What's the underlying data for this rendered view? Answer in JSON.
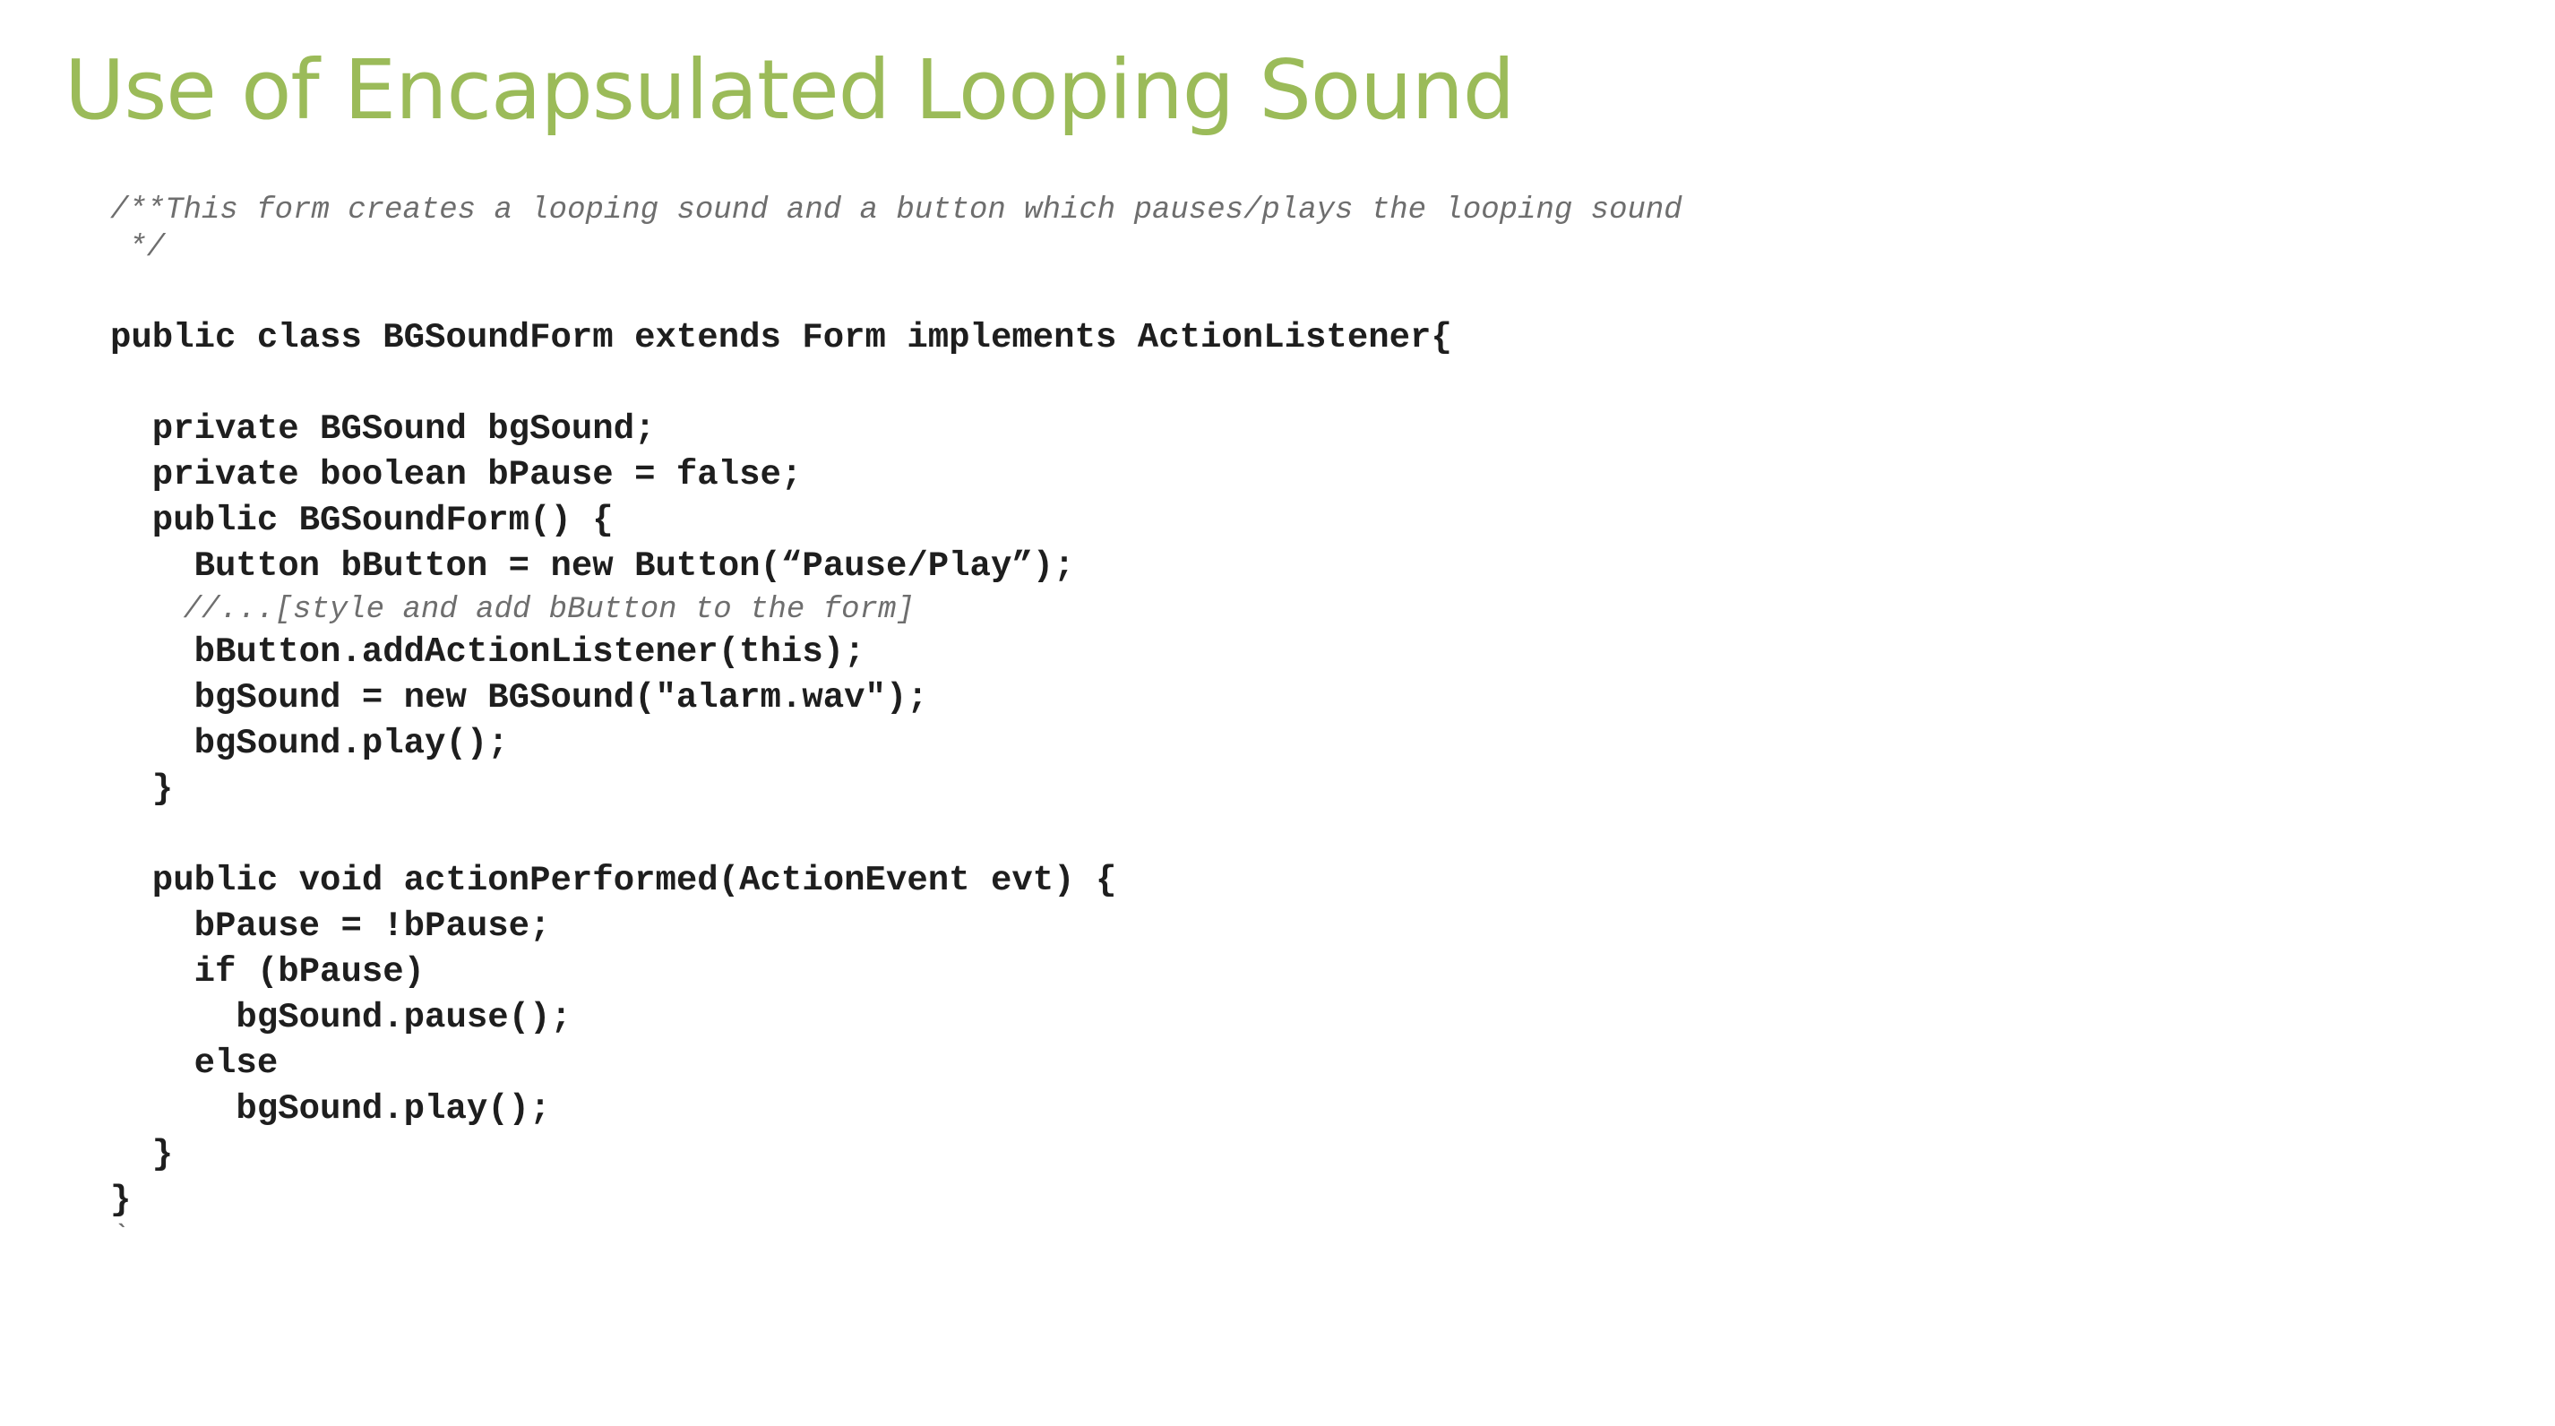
{
  "slide": {
    "title": "Use of Encapsulated Looping Sound"
  },
  "code": {
    "lines": [
      {
        "text": "/**This form creates a looping sound and a button which pauses/plays the looping sound",
        "kind": "comment"
      },
      {
        "text": " */",
        "kind": "comment"
      },
      {
        "text": "public class BGSoundForm extends Form implements ActionListener{",
        "kind": "code"
      },
      {
        "text": "  private BGSound bgSound;",
        "kind": "code"
      },
      {
        "text": "  private boolean bPause = false;",
        "kind": "code"
      },
      {
        "text": "  public BGSoundForm() {",
        "kind": "code"
      },
      {
        "text": "    Button bButton = new Button(“Pause/Play”);",
        "kind": "code"
      },
      {
        "text": "    //...[style and add bButton to the form]",
        "kind": "comment"
      },
      {
        "text": "    bButton.addActionListener(this);",
        "kind": "code"
      },
      {
        "text": "    bgSound = new BGSound(\"alarm.wav\");",
        "kind": "code"
      },
      {
        "text": "    bgSound.play();",
        "kind": "code"
      },
      {
        "text": "  }",
        "kind": "code"
      },
      {
        "text": "  public void actionPerformed(ActionEvent evt) {",
        "kind": "code"
      },
      {
        "text": "    bPause = !bPause;",
        "kind": "code"
      },
      {
        "text": "    if (bPause)",
        "kind": "code"
      },
      {
        "text": "      bgSound.pause();",
        "kind": "code"
      },
      {
        "text": "    else",
        "kind": "code"
      },
      {
        "text": "      bgSound.play();",
        "kind": "code"
      },
      {
        "text": "  }",
        "kind": "code"
      },
      {
        "text": "}",
        "kind": "code"
      },
      {
        "text": "`",
        "kind": "comment"
      }
    ]
  }
}
